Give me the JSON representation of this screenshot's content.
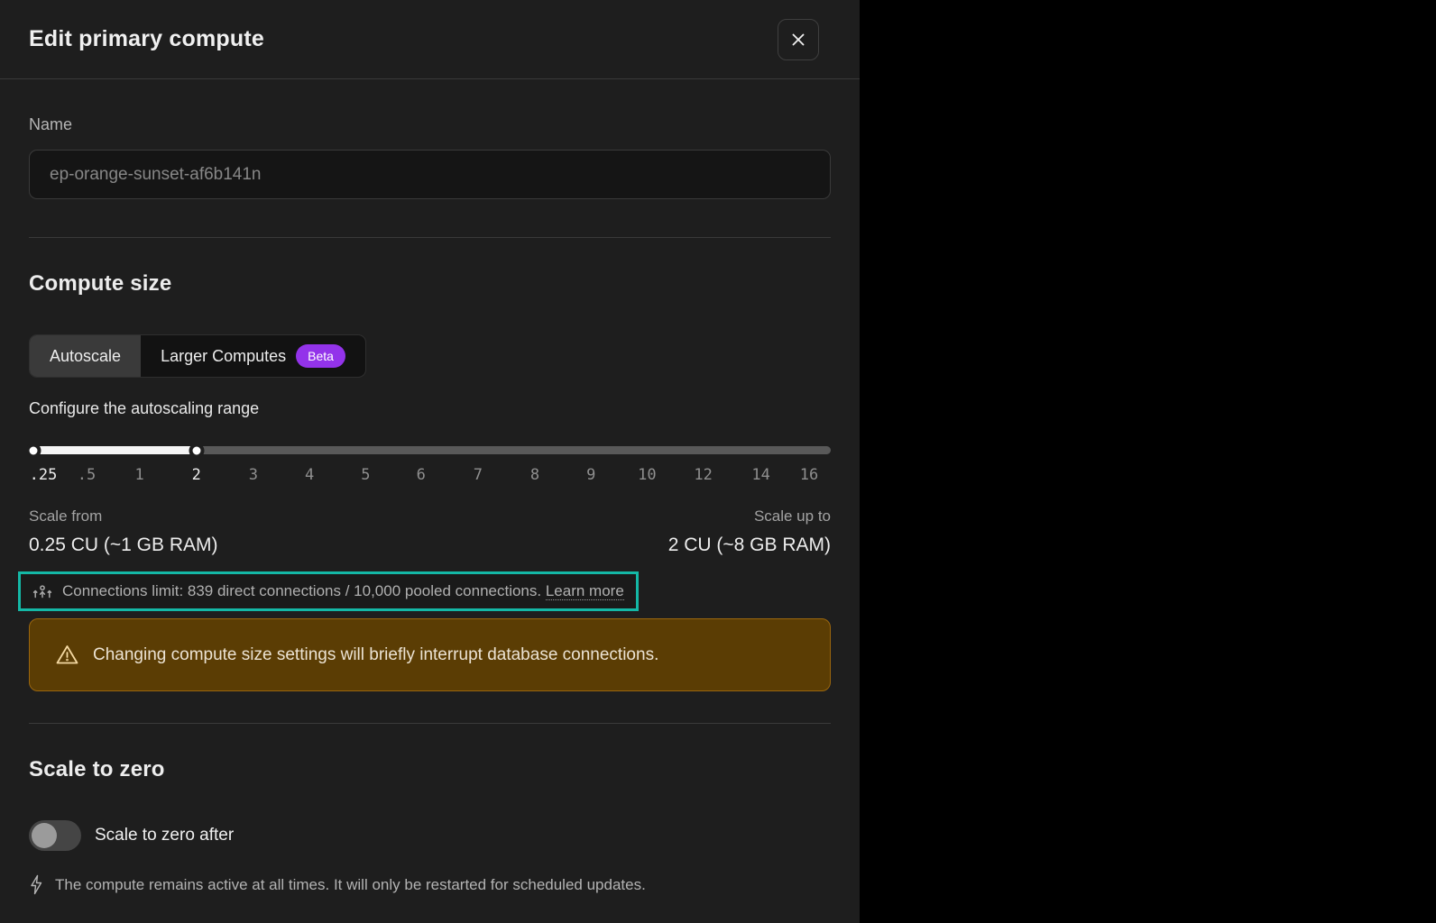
{
  "modal": {
    "title": "Edit primary compute"
  },
  "name_section": {
    "label": "Name",
    "placeholder": "ep-orange-sunset-af6b141n",
    "value": ""
  },
  "compute_size": {
    "heading": "Compute size",
    "tabs": [
      {
        "label": "Autoscale",
        "selected": true
      },
      {
        "label": "Larger Computes",
        "badge": "Beta",
        "selected": false
      }
    ],
    "slider": {
      "label": "Configure the autoscaling range",
      "low_value": ".25",
      "high_value": "2",
      "handle_low_pct": 0.6,
      "handle_high_pct": 20.9,
      "ticks": [
        {
          "label": ".25",
          "pct": 1.8,
          "active": true
        },
        {
          "label": ".5",
          "pct": 7.2,
          "active": false
        },
        {
          "label": "1",
          "pct": 13.8,
          "active": false
        },
        {
          "label": "2",
          "pct": 20.9,
          "active": true
        },
        {
          "label": "3",
          "pct": 28.0,
          "active": false
        },
        {
          "label": "4",
          "pct": 35.0,
          "active": false
        },
        {
          "label": "5",
          "pct": 42.0,
          "active": false
        },
        {
          "label": "6",
          "pct": 48.9,
          "active": false
        },
        {
          "label": "7",
          "pct": 56.0,
          "active": false
        },
        {
          "label": "8",
          "pct": 63.1,
          "active": false
        },
        {
          "label": "9",
          "pct": 70.1,
          "active": false
        },
        {
          "label": "10",
          "pct": 77.1,
          "active": false
        },
        {
          "label": "12",
          "pct": 84.1,
          "active": false
        },
        {
          "label": "14",
          "pct": 91.3,
          "active": false
        },
        {
          "label": "16",
          "pct": 97.3,
          "active": false
        }
      ]
    },
    "scale_from": {
      "label": "Scale from",
      "value": "0.25 CU (~1 GB RAM)"
    },
    "scale_up_to": {
      "label": "Scale up to",
      "value": "2 CU (~8 GB RAM)"
    },
    "connections_note": {
      "text": "Connections limit: 839 direct connections / 10,000 pooled connections.",
      "link_label": "Learn more"
    },
    "warning": "Changing compute size settings will briefly interrupt database connections."
  },
  "scale_to_zero": {
    "heading": "Scale to zero",
    "toggle_label": "Scale to zero after",
    "toggle_on": false,
    "note": "The compute remains active at all times. It will only be restarted for scheduled updates."
  },
  "colors": {
    "highlight_teal": "#14b8a6",
    "beta_purple": "#9333ea",
    "warning_bg": "#5b3d04",
    "warning_border": "#9a660e",
    "warning_icon": "#f5d9a2"
  }
}
